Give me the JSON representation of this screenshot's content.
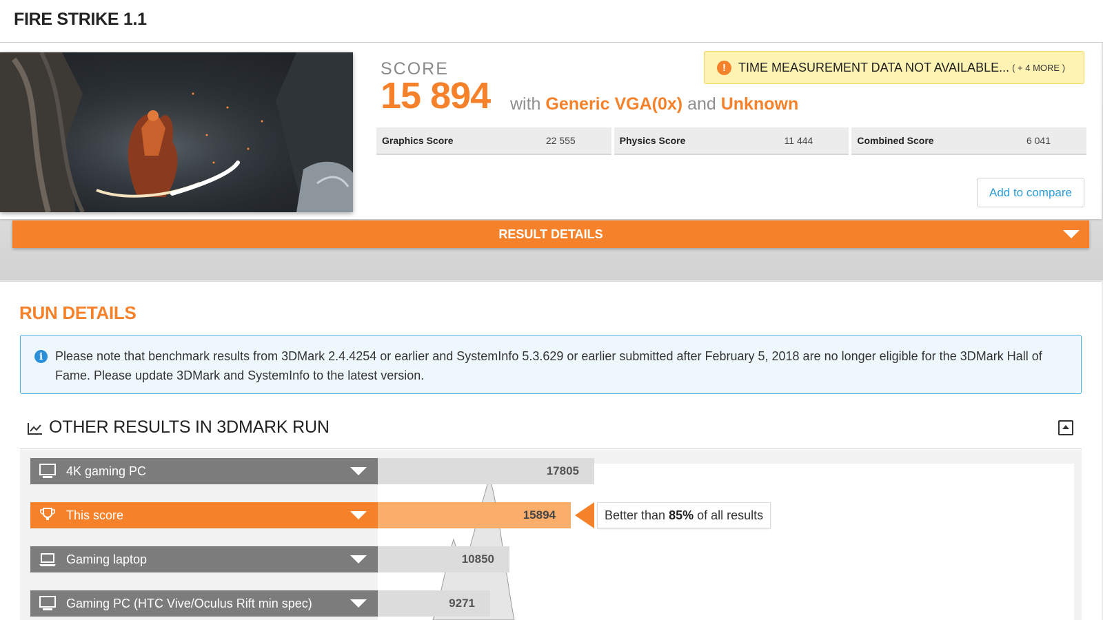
{
  "header": {
    "title": "FIRE STRIKE 1.1"
  },
  "score": {
    "label": "SCORE",
    "value": "15 894",
    "with_word": "with",
    "gpu": "Generic VGA(0x)",
    "and_word": "and",
    "cpu": "Unknown"
  },
  "warning": {
    "text": "TIME MEASUREMENT DATA NOT AVAILABLE...",
    "more": "( + 4 MORE )",
    "icon": "exclamation-icon"
  },
  "subscores": [
    {
      "label": "Graphics Score",
      "value": "22 555"
    },
    {
      "label": "Physics Score",
      "value": "11 444"
    },
    {
      "label": "Combined Score",
      "value": "6 041"
    }
  ],
  "compare_label": "Add to compare",
  "result_details_label": "RESULT DETAILS",
  "run_details": {
    "title": "RUN DETAILS",
    "notice": "Please note that benchmark results from 3DMark 2.4.4254 or earlier and SystemInfo 5.3.629 or earlier submitted after February 5, 2018 are no longer eligible for the 3DMark Hall of Fame. Please update 3DMark and SystemInfo to the latest version."
  },
  "other_results": {
    "title": "OTHER RESULTS IN 3DMARK RUN",
    "rows": [
      {
        "label": "4K gaming PC",
        "value": "17805",
        "score": 17805,
        "icon": "desktop-icon",
        "active": false
      },
      {
        "label": "This score",
        "value": "15894",
        "score": 15894,
        "icon": "trophy-icon",
        "active": true
      },
      {
        "label": "Gaming laptop",
        "value": "10850",
        "score": 10850,
        "icon": "laptop-icon",
        "active": false
      },
      {
        "label": "Gaming PC (HTC Vive/Oculus Rift min spec)",
        "value": "9271",
        "score": 9271,
        "icon": "desktop-icon",
        "active": false
      }
    ],
    "better_prefix": "Better than",
    "better_percent": "85%",
    "better_suffix": "of all results"
  },
  "colors": {
    "accent": "#f5822a",
    "info": "#2a8fd6",
    "link": "#2a9bd6"
  }
}
